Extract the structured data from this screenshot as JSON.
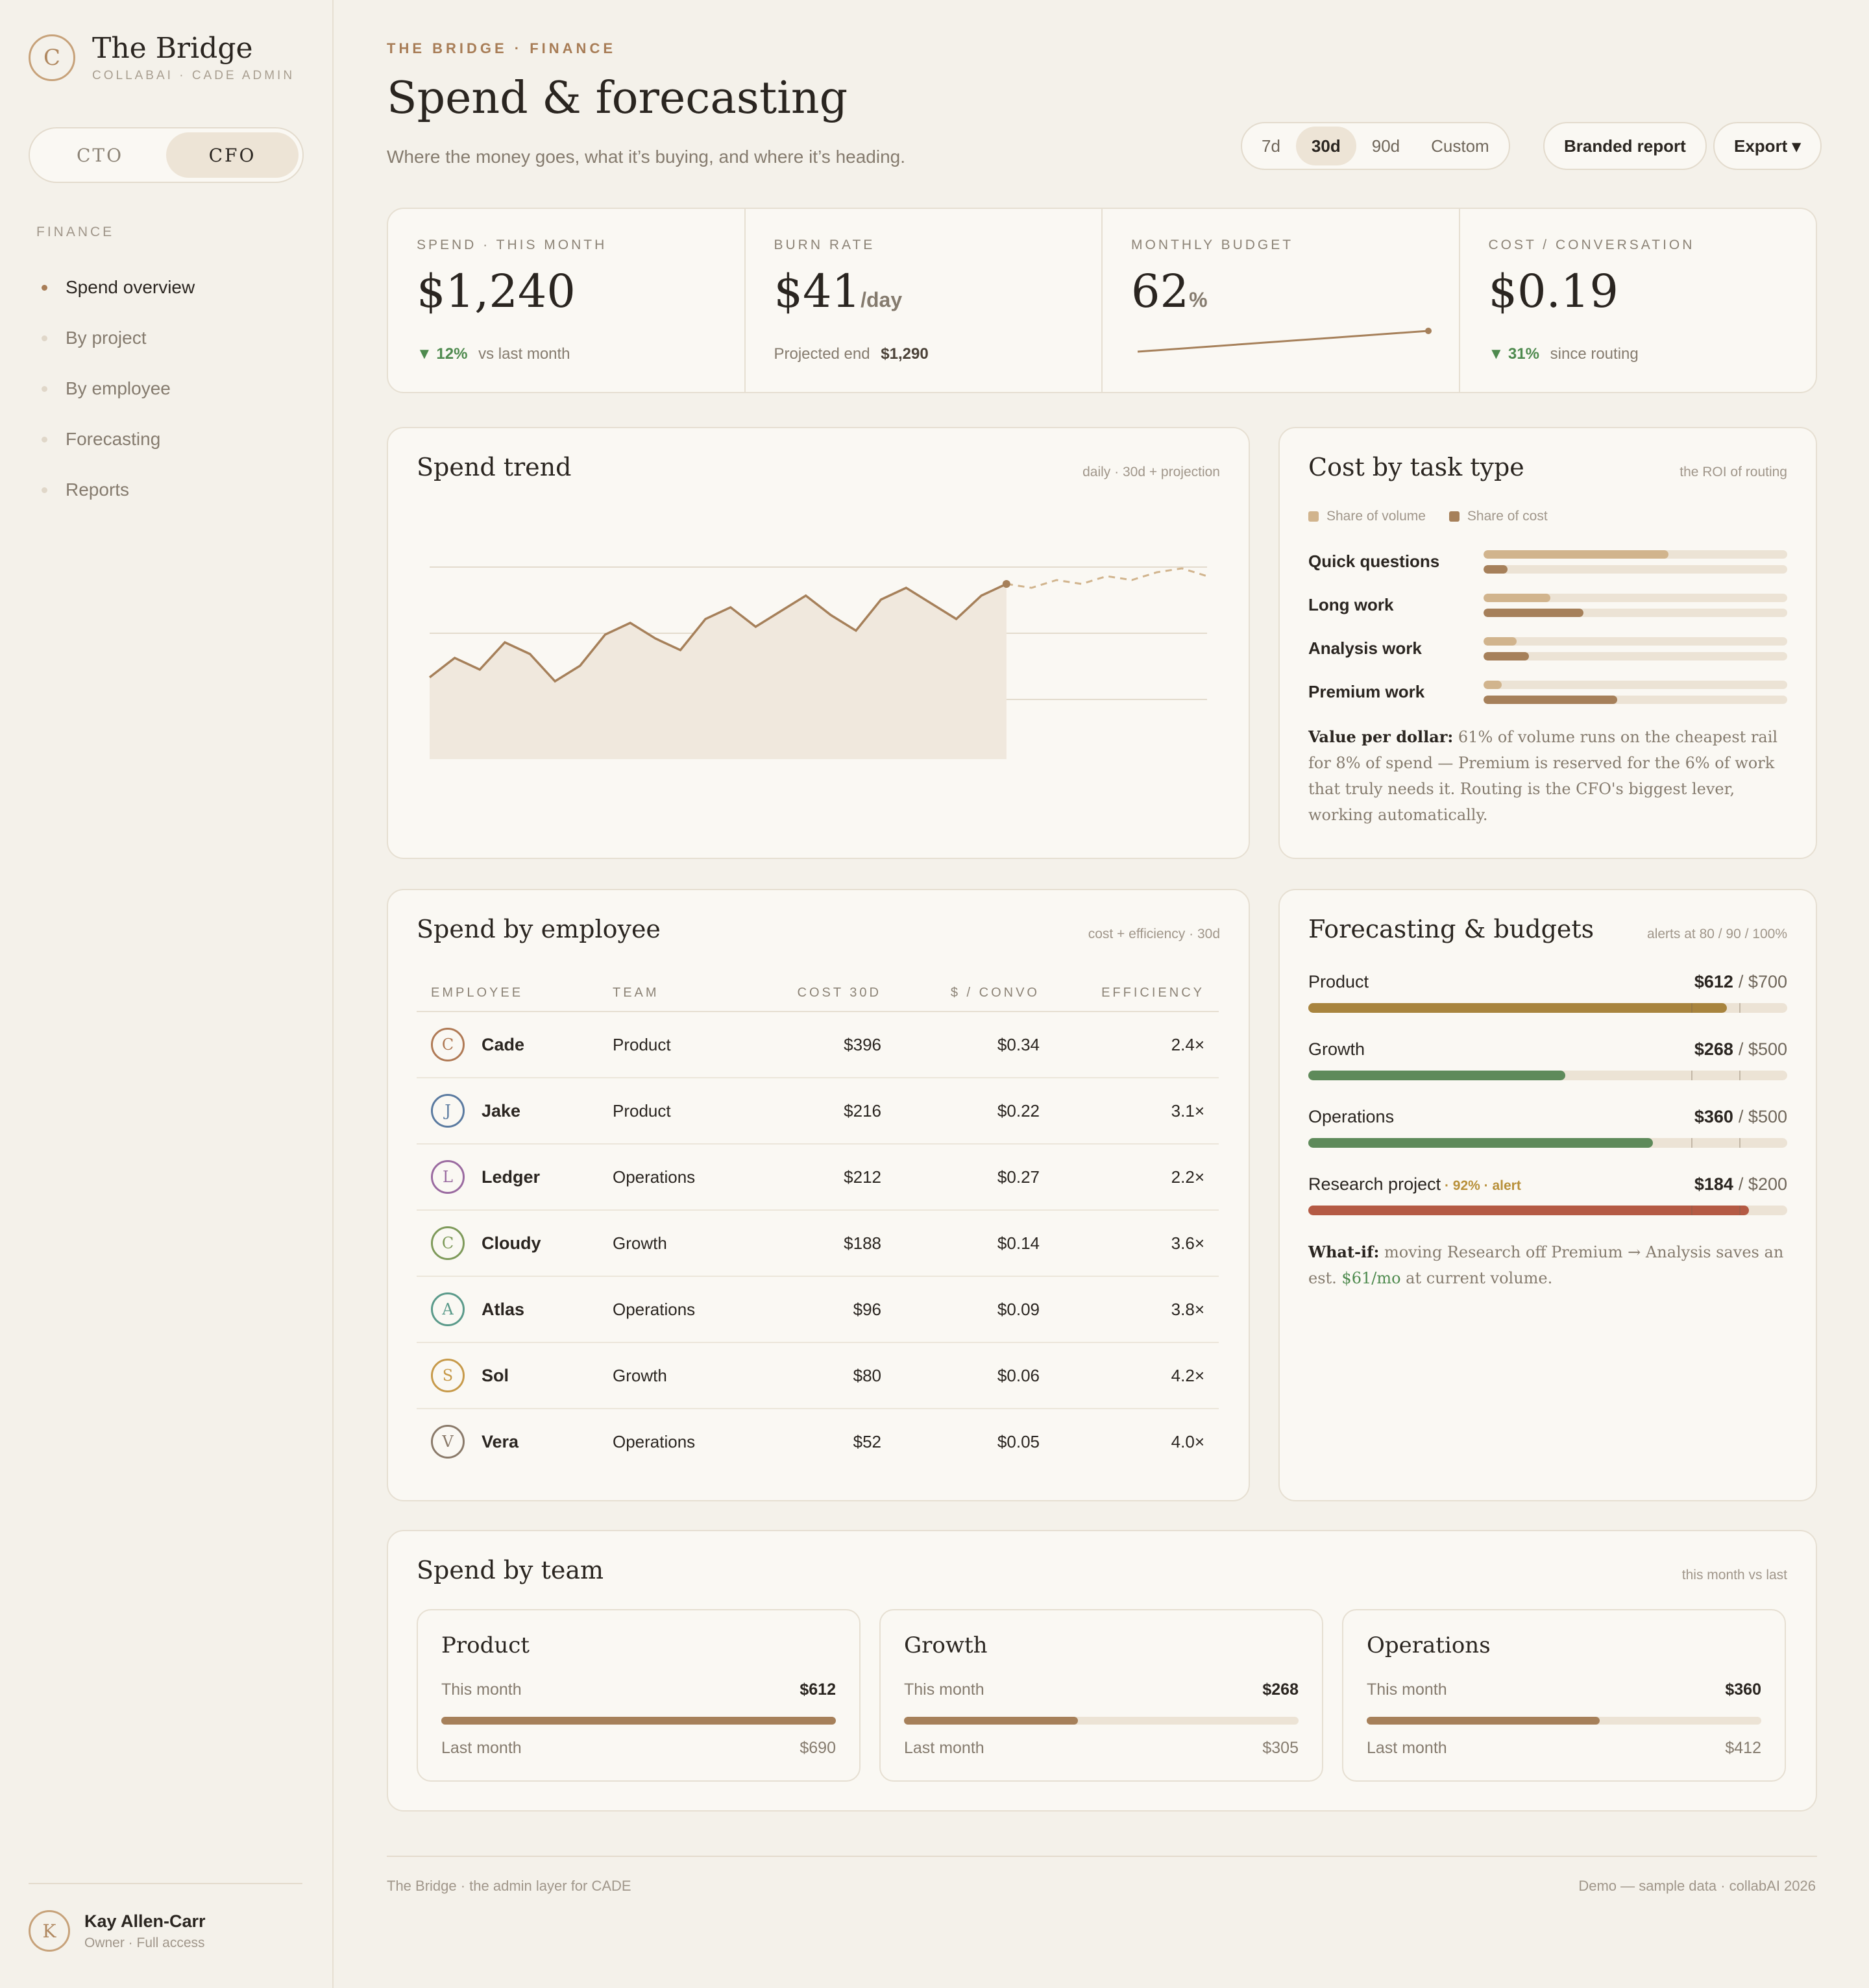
{
  "brand": {
    "mark": "C",
    "title": "The Bridge",
    "subtitle": "COLLABAI · CADE ADMIN"
  },
  "roles": [
    "CTO",
    "CFO"
  ],
  "active_role": "CFO",
  "nav": {
    "heading": "FINANCE",
    "items": [
      {
        "label": "Spend overview",
        "active": true
      },
      {
        "label": "By project",
        "active": false
      },
      {
        "label": "By employee",
        "active": false
      },
      {
        "label": "Forecasting",
        "active": false
      },
      {
        "label": "Reports",
        "active": false
      }
    ]
  },
  "user": {
    "initial": "K",
    "name": "Kay Allen-Carr",
    "role": "Owner · Full access"
  },
  "header": {
    "eyebrow": "THE BRIDGE · FINANCE",
    "title": "Spend & forecasting",
    "subtitle": "Where the money goes, what it’s buying, and where it’s heading.",
    "ranges": [
      "7d",
      "30d",
      "90d",
      "Custom"
    ],
    "active_range": "30d",
    "branded_report": "Branded report",
    "export": "Export ▾"
  },
  "kpis": [
    {
      "label": "SPEND · THIS MONTH",
      "value": "$1,240",
      "unit": "",
      "delta": "▼ 12%",
      "foot": "vs last month"
    },
    {
      "label": "BURN RATE",
      "value": "$41",
      "unit": "/day",
      "foot_label": "Projected end",
      "foot_value": "$1,290"
    },
    {
      "label": "MONTHLY BUDGET",
      "value": "62",
      "unit": "%",
      "budget_used_fraction": 0.62
    },
    {
      "label": "COST / CONVERSATION",
      "value": "$0.19",
      "unit": "",
      "delta": "▼ 31%",
      "foot": "since routing"
    }
  ],
  "spend_trend": {
    "title": "Spend trend",
    "meta": "daily · 30d + projection"
  },
  "chart_data": {
    "type": "area",
    "title": "Spend trend",
    "x": [
      1,
      2,
      3,
      4,
      5,
      6,
      7,
      8,
      9,
      10,
      11,
      12,
      13,
      14,
      15,
      16,
      17,
      18,
      19,
      20,
      21,
      22,
      23,
      24,
      25,
      26,
      27,
      28,
      29,
      30
    ],
    "series": [
      {
        "values": [
          21,
          26,
          23,
          30,
          27,
          20,
          24,
          32,
          35,
          31,
          28,
          36,
          39,
          34,
          38,
          42,
          37,
          33,
          41,
          44,
          40,
          36,
          42,
          45
        ]
      },
      {
        "values": [
          45,
          44,
          46,
          45,
          47,
          46,
          48,
          49,
          47
        ]
      }
    ],
    "ylim": [
      0,
      68
    ],
    "grid": true
  },
  "cost_by_task": {
    "title": "Cost by task type",
    "meta": "the ROI of routing",
    "legend": [
      "Share of volume",
      "Share of cost"
    ],
    "colors": {
      "volume": "#d1b48d",
      "cost": "#a6805a"
    },
    "rows": [
      {
        "label": "Quick questions",
        "volume": 0.61,
        "cost": 0.08
      },
      {
        "label": "Long work",
        "volume": 0.22,
        "cost": 0.33
      },
      {
        "label": "Analysis work",
        "volume": 0.11,
        "cost": 0.15
      },
      {
        "label": "Premium work",
        "volume": 0.06,
        "cost": 0.44
      }
    ],
    "note_lead": "Value per dollar:",
    "note_body": " 61% of volume runs on the cheapest rail for 8% of spend — Premium is reserved for the 6% of work that truly needs it. Routing is the CFO's biggest lever, working automatically."
  },
  "employees": {
    "title": "Spend by employee",
    "meta": "cost + efficiency · 30d",
    "columns": [
      "EMPLOYEE",
      "TEAM",
      "COST 30D",
      "$ / CONVO",
      "EFFICIENCY"
    ],
    "rows": [
      {
        "initial": "C",
        "name": "Cade",
        "team": "Product",
        "cost": "$396",
        "convo": "$0.34",
        "eff": "2.4×",
        "color": "#b07a55"
      },
      {
        "initial": "J",
        "name": "Jake",
        "team": "Product",
        "cost": "$216",
        "convo": "$0.22",
        "eff": "3.1×",
        "color": "#5a7aa0"
      },
      {
        "initial": "L",
        "name": "Ledger",
        "team": "Operations",
        "cost": "$212",
        "convo": "$0.27",
        "eff": "2.2×",
        "color": "#9a6aa0"
      },
      {
        "initial": "C",
        "name": "Cloudy",
        "team": "Growth",
        "cost": "$188",
        "convo": "$0.14",
        "eff": "3.6×",
        "color": "#7e9a5a"
      },
      {
        "initial": "A",
        "name": "Atlas",
        "team": "Operations",
        "cost": "$96",
        "convo": "$0.09",
        "eff": "3.8×",
        "color": "#5a9a8a"
      },
      {
        "initial": "S",
        "name": "Sol",
        "team": "Growth",
        "cost": "$80",
        "convo": "$0.06",
        "eff": "4.2×",
        "color": "#c79a4a"
      },
      {
        "initial": "V",
        "name": "Vera",
        "team": "Operations",
        "cost": "$52",
        "convo": "$0.05",
        "eff": "4.0×",
        "color": "#8a7a6a"
      }
    ]
  },
  "budgets": {
    "title": "Forecasting & budgets",
    "meta": "alerts at 80 / 90 / 100%",
    "rows": [
      {
        "name": "Product",
        "alert": "",
        "spent": "$612",
        "limit": "/ $700",
        "fraction": 0.874,
        "color": "#a8843e"
      },
      {
        "name": "Growth",
        "alert": "",
        "spent": "$268",
        "limit": "/ $500",
        "fraction": 0.536,
        "color": "#5e8a5a"
      },
      {
        "name": "Operations",
        "alert": "",
        "spent": "$360",
        "limit": "/ $500",
        "fraction": 0.72,
        "color": "#5e8a5a"
      },
      {
        "name": "Research project",
        "alert": " · 92% · alert",
        "spent": "$184",
        "limit": "/ $200",
        "fraction": 0.92,
        "color": "#b45a44"
      }
    ],
    "note_lead": "What-if:",
    "note_body": " moving Research off Premium → Analysis saves an est. ",
    "note_highlight": "$61/mo",
    "note_tail": " at current volume."
  },
  "teams": {
    "title": "Spend by team",
    "meta": "this month vs last",
    "this_label": "This month",
    "last_label": "Last month",
    "cards": [
      {
        "name": "Product",
        "this": "$612",
        "last": "$690",
        "fraction": 1.0
      },
      {
        "name": "Growth",
        "this": "$268",
        "last": "$305",
        "fraction": 0.44
      },
      {
        "name": "Operations",
        "this": "$360",
        "last": "$412",
        "fraction": 0.59
      }
    ]
  },
  "footer": {
    "left": "The Bridge · the admin layer for CADE",
    "right": "Demo — sample data · collabAI 2026"
  }
}
